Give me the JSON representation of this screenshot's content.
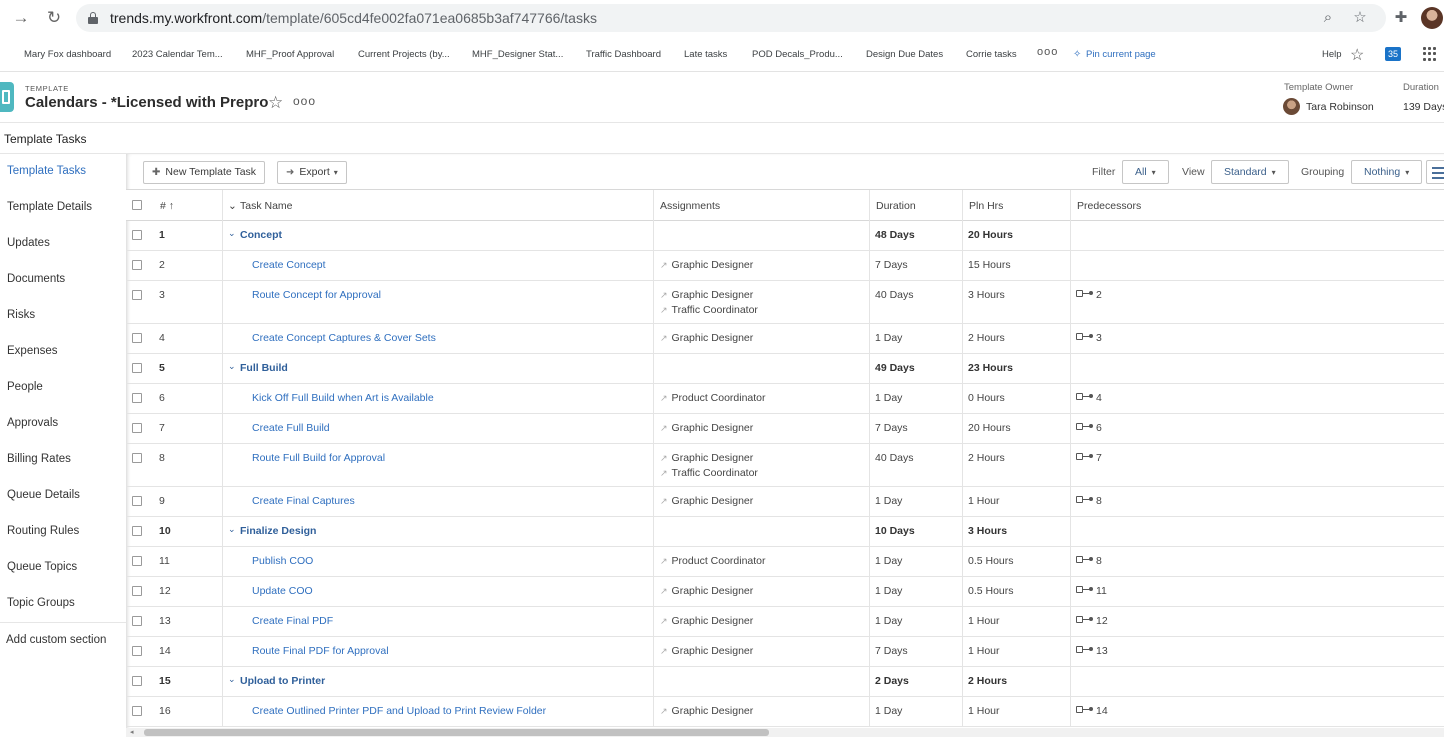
{
  "browser": {
    "url_host": "trends.my.workfront.com",
    "url_path": "/template/605cd4fe002fa071ea0685b3af747766/tasks"
  },
  "bookmarks": [
    "Mary Fox dashboard",
    "2023 Calendar Tem...",
    "MHF_Proof Approval",
    "Current Projects (by...",
    "MHF_Designer Stat...",
    "Traffic Dashboard",
    "Late tasks",
    "POD Decals_Produ...",
    "Design Due Dates",
    "Corrie tasks"
  ],
  "bookmarks_more": "ooo",
  "pin_label": "Pin current page",
  "help_label": "Help",
  "notification_count": "35",
  "template": {
    "kind": "TEMPLATE",
    "title": "Calendars - *Licensed with Prepro",
    "owner_label": "Template Owner",
    "owner_name": "Tara Robinson",
    "duration_label": "Duration",
    "duration_value": "139 Days"
  },
  "section_title": "Template Tasks",
  "leftnav": {
    "items": [
      "Template Tasks",
      "Template Details",
      "Updates",
      "Documents",
      "Risks",
      "Expenses",
      "People",
      "Approvals",
      "Billing Rates",
      "Queue Details",
      "Routing Rules",
      "Queue Topics",
      "Topic Groups"
    ],
    "add_section": "Add custom section"
  },
  "toolbar": {
    "new_task": "New Template Task",
    "export": "Export",
    "filter_label": "Filter",
    "filter_value": "All",
    "view_label": "View",
    "view_value": "Standard",
    "grouping_label": "Grouping",
    "grouping_value": "Nothing"
  },
  "columns": {
    "num": "# ↑",
    "task_name": "Task Name",
    "assignments": "Assignments",
    "duration": "Duration",
    "pln_hrs": "Pln Hrs",
    "predecessors": "Predecessors"
  },
  "tasks": [
    {
      "num": "1",
      "name": "Concept",
      "parent": true,
      "assignments": [],
      "duration": "48 Days",
      "hours": "20 Hours",
      "pred": ""
    },
    {
      "num": "2",
      "name": "Create Concept",
      "parent": false,
      "assignments": [
        "Graphic Designer"
      ],
      "duration": "7 Days",
      "hours": "15 Hours",
      "pred": ""
    },
    {
      "num": "3",
      "name": "Route Concept for Approval",
      "parent": false,
      "assignments": [
        "Graphic Designer",
        "Traffic Coordinator"
      ],
      "duration": "40 Days",
      "hours": "3 Hours",
      "pred": "2"
    },
    {
      "num": "4",
      "name": "Create Concept Captures & Cover Sets",
      "parent": false,
      "assignments": [
        "Graphic Designer"
      ],
      "duration": "1 Day",
      "hours": "2 Hours",
      "pred": "3"
    },
    {
      "num": "5",
      "name": "Full Build",
      "parent": true,
      "assignments": [],
      "duration": "49 Days",
      "hours": "23 Hours",
      "pred": ""
    },
    {
      "num": "6",
      "name": "Kick Off Full Build when Art is Available",
      "parent": false,
      "assignments": [
        "Product Coordinator"
      ],
      "duration": "1 Day",
      "hours": "0 Hours",
      "pred": "4"
    },
    {
      "num": "7",
      "name": "Create Full Build",
      "parent": false,
      "assignments": [
        "Graphic Designer"
      ],
      "duration": "7 Days",
      "hours": "20 Hours",
      "pred": "6"
    },
    {
      "num": "8",
      "name": "Route Full Build for Approval",
      "parent": false,
      "assignments": [
        "Graphic Designer",
        "Traffic Coordinator"
      ],
      "duration": "40 Days",
      "hours": "2 Hours",
      "pred": "7"
    },
    {
      "num": "9",
      "name": "Create Final Captures",
      "parent": false,
      "assignments": [
        "Graphic Designer"
      ],
      "duration": "1 Day",
      "hours": "1 Hour",
      "pred": "8"
    },
    {
      "num": "10",
      "name": "Finalize Design",
      "parent": true,
      "assignments": [],
      "duration": "10 Days",
      "hours": "3 Hours",
      "pred": ""
    },
    {
      "num": "11",
      "name": "Publish COO",
      "parent": false,
      "assignments": [
        "Product Coordinator"
      ],
      "duration": "1 Day",
      "hours": "0.5 Hours",
      "pred": "8"
    },
    {
      "num": "12",
      "name": "Update COO",
      "parent": false,
      "assignments": [
        "Graphic Designer"
      ],
      "duration": "1 Day",
      "hours": "0.5 Hours",
      "pred": "11"
    },
    {
      "num": "13",
      "name": "Create Final PDF",
      "parent": false,
      "assignments": [
        "Graphic Designer"
      ],
      "duration": "1 Day",
      "hours": "1 Hour",
      "pred": "12"
    },
    {
      "num": "14",
      "name": "Route Final PDF for Approval",
      "parent": false,
      "assignments": [
        "Graphic Designer"
      ],
      "duration": "7 Days",
      "hours": "1 Hour",
      "pred": "13"
    },
    {
      "num": "15",
      "name": "Upload to Printer",
      "parent": true,
      "assignments": [],
      "duration": "2 Days",
      "hours": "2 Hours",
      "pred": ""
    },
    {
      "num": "16",
      "name": "Create Outlined Printer PDF and Upload to Print Review Folder",
      "parent": false,
      "assignments": [
        "Graphic Designer"
      ],
      "duration": "1 Day",
      "hours": "1 Hour",
      "pred": "14"
    }
  ]
}
